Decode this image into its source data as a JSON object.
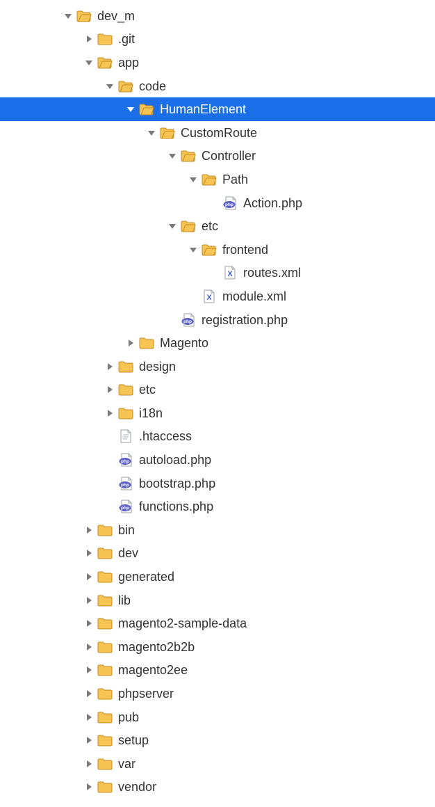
{
  "indentBase": 92,
  "indentStep": 30,
  "rowHeight": 33.6,
  "colors": {
    "selection": "#1a6fe8",
    "arrow": "#7b7b7b",
    "arrowSelected": "#ffffff",
    "folderFill": "#f6c452",
    "folderStroke": "#c98a1f",
    "fileFill": "#ffffff",
    "fileStroke": "#9aa0a8",
    "phpBadge": "#5a5fc7",
    "xmlBadge": "#3b63c9",
    "textLine": "#b8bec7"
  },
  "tree": [
    {
      "depth": 0,
      "label": "dev_m",
      "icon": "folder-open",
      "arrow": "down",
      "selected": false
    },
    {
      "depth": 1,
      "label": ".git",
      "icon": "folder",
      "arrow": "right",
      "selected": false
    },
    {
      "depth": 1,
      "label": "app",
      "icon": "folder-open",
      "arrow": "down",
      "selected": false
    },
    {
      "depth": 2,
      "label": "code",
      "icon": "folder-open",
      "arrow": "down",
      "selected": false
    },
    {
      "depth": 3,
      "label": "HumanElement",
      "icon": "folder-open",
      "arrow": "down",
      "selected": true
    },
    {
      "depth": 4,
      "label": "CustomRoute",
      "icon": "folder-open",
      "arrow": "down",
      "selected": false
    },
    {
      "depth": 5,
      "label": "Controller",
      "icon": "folder-open",
      "arrow": "down",
      "selected": false
    },
    {
      "depth": 6,
      "label": "Path",
      "icon": "folder-open",
      "arrow": "down",
      "selected": false
    },
    {
      "depth": 7,
      "label": "Action.php",
      "icon": "php",
      "arrow": "none",
      "selected": false
    },
    {
      "depth": 5,
      "label": "etc",
      "icon": "folder-open",
      "arrow": "down",
      "selected": false
    },
    {
      "depth": 6,
      "label": "frontend",
      "icon": "folder-open",
      "arrow": "down",
      "selected": false
    },
    {
      "depth": 7,
      "label": "routes.xml",
      "icon": "xml",
      "arrow": "none",
      "selected": false
    },
    {
      "depth": 6,
      "label": "module.xml",
      "icon": "xml",
      "arrow": "none",
      "selected": false
    },
    {
      "depth": 5,
      "label": "registration.php",
      "icon": "php",
      "arrow": "none",
      "selected": false
    },
    {
      "depth": 3,
      "label": "Magento",
      "icon": "folder",
      "arrow": "right",
      "selected": false
    },
    {
      "depth": 2,
      "label": "design",
      "icon": "folder",
      "arrow": "right",
      "selected": false
    },
    {
      "depth": 2,
      "label": "etc",
      "icon": "folder",
      "arrow": "right",
      "selected": false
    },
    {
      "depth": 2,
      "label": "i18n",
      "icon": "folder",
      "arrow": "right",
      "selected": false
    },
    {
      "depth": 2,
      "label": ".htaccess",
      "icon": "text",
      "arrow": "none",
      "selected": false
    },
    {
      "depth": 2,
      "label": "autoload.php",
      "icon": "php",
      "arrow": "none",
      "selected": false
    },
    {
      "depth": 2,
      "label": "bootstrap.php",
      "icon": "php",
      "arrow": "none",
      "selected": false
    },
    {
      "depth": 2,
      "label": "functions.php",
      "icon": "php",
      "arrow": "none",
      "selected": false
    },
    {
      "depth": 1,
      "label": "bin",
      "icon": "folder",
      "arrow": "right",
      "selected": false
    },
    {
      "depth": 1,
      "label": "dev",
      "icon": "folder",
      "arrow": "right",
      "selected": false
    },
    {
      "depth": 1,
      "label": "generated",
      "icon": "folder",
      "arrow": "right",
      "selected": false
    },
    {
      "depth": 1,
      "label": "lib",
      "icon": "folder",
      "arrow": "right",
      "selected": false
    },
    {
      "depth": 1,
      "label": "magento2-sample-data",
      "icon": "folder",
      "arrow": "right",
      "selected": false
    },
    {
      "depth": 1,
      "label": "magento2b2b",
      "icon": "folder",
      "arrow": "right",
      "selected": false
    },
    {
      "depth": 1,
      "label": "magento2ee",
      "icon": "folder",
      "arrow": "right",
      "selected": false
    },
    {
      "depth": 1,
      "label": "phpserver",
      "icon": "folder",
      "arrow": "right",
      "selected": false
    },
    {
      "depth": 1,
      "label": "pub",
      "icon": "folder",
      "arrow": "right",
      "selected": false
    },
    {
      "depth": 1,
      "label": "setup",
      "icon": "folder",
      "arrow": "right",
      "selected": false
    },
    {
      "depth": 1,
      "label": "var",
      "icon": "folder",
      "arrow": "right",
      "selected": false
    },
    {
      "depth": 1,
      "label": "vendor",
      "icon": "folder",
      "arrow": "right",
      "selected": false
    }
  ]
}
